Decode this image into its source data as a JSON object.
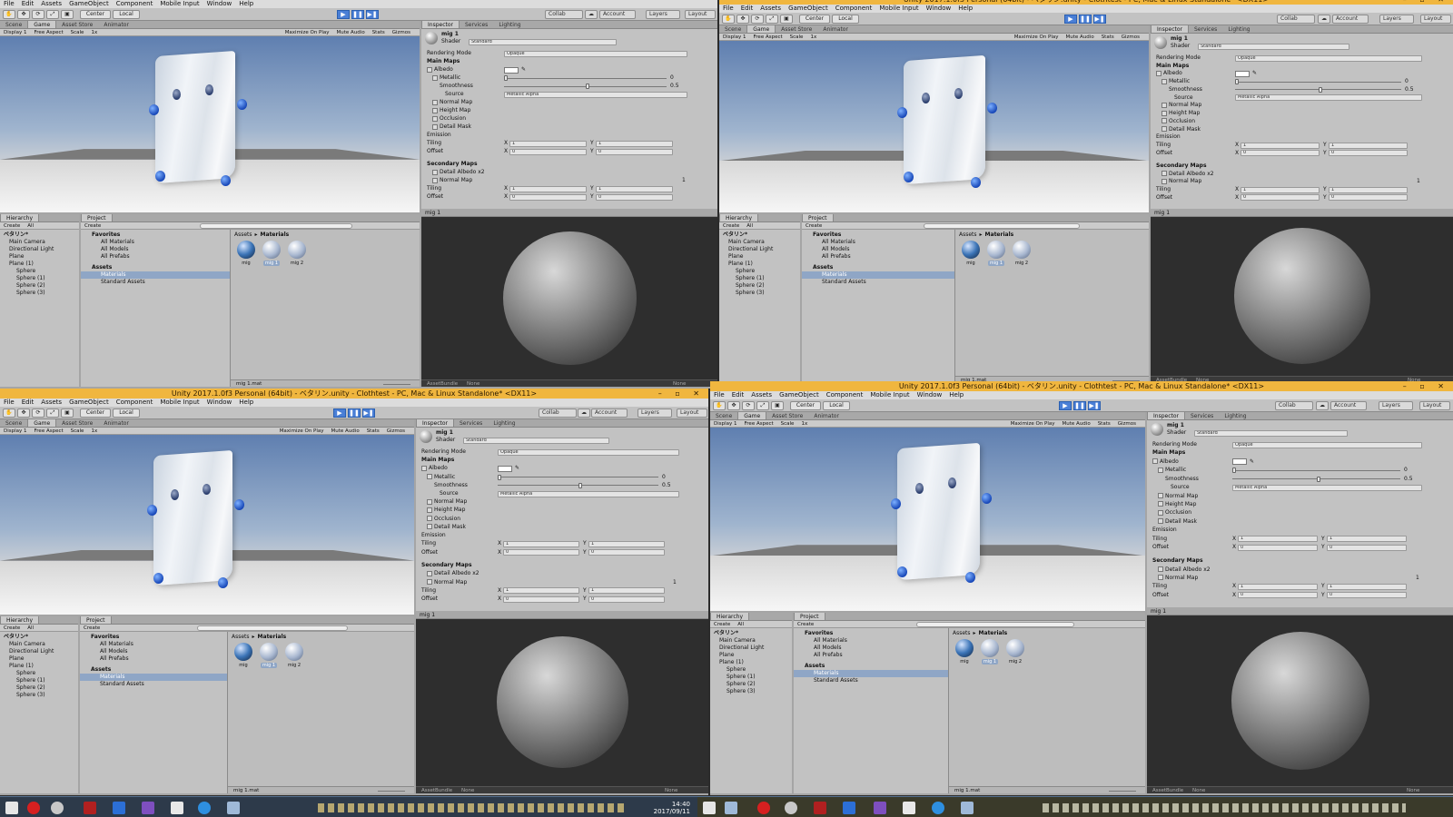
{
  "title": "Unity 2017.1.0f3 Personal (64bit) - ベタリン.unity - Clothtest - PC, Mac & Linux Standalone* <DX11>",
  "menu": [
    "File",
    "Edit",
    "Assets",
    "GameObject",
    "Component",
    "Mobile Input",
    "Window",
    "Help"
  ],
  "toolbar": {
    "center": "Center",
    "local": "Local",
    "collab": "Collab",
    "account": "Account",
    "layers": "Layers",
    "layout": "Layout"
  },
  "tabs": {
    "scene": "Scene",
    "game": "Game",
    "asset_store": "Asset Store",
    "animator": "Animator"
  },
  "game_bar": {
    "display": "Display 1",
    "aspect": "Free Aspect",
    "scale": "Scale",
    "scale_val": "1x",
    "maximize": "Maximize On Play",
    "mute": "Mute Audio",
    "stats": "Stats",
    "gizmos": "Gizmos"
  },
  "inspector": {
    "tabs": [
      "Inspector",
      "Services",
      "Lighting"
    ],
    "name": "mig 1",
    "shader_label": "Shader",
    "shader_value": "Standard",
    "rendering_mode": "Rendering Mode",
    "rendering_value": "Opaque",
    "main_maps": "Main Maps",
    "albedo": "Albedo",
    "metallic": "Metallic",
    "metallic_value": "0",
    "smoothness": "Smoothness",
    "smoothness_value": "0.5",
    "smoothness_level": 0.5,
    "source": "Source",
    "source_value": "Metallic Alpha",
    "normal_map": "Normal Map",
    "height_map": "Height Map",
    "occlusion": "Occlusion",
    "detail_mask": "Detail Mask",
    "emission": "Emission",
    "tiling": "Tiling",
    "offset": "Offset",
    "x": "X",
    "y": "Y",
    "tiling_x": "1",
    "tiling_y": "1",
    "offset_x": "0",
    "offset_y": "0",
    "secondary_maps": "Secondary Maps",
    "detail_albedo": "Detail Albedo x2",
    "normal_map2": "Normal Map",
    "normal_scale": "1"
  },
  "preview": {
    "name": "mig 1",
    "asset_bundle": "AssetBundle",
    "none": "None"
  },
  "hierarchy": {
    "tab": "Hierarchy",
    "create": "Create",
    "search": "All",
    "scene": "ベタリン*",
    "items": [
      "Main Camera",
      "Directional Light",
      "Plane",
      "Plane (1)",
      "Sphere",
      "Sphere (1)",
      "Sphere (2)",
      "Sphere (3)"
    ]
  },
  "project": {
    "tab": "Project",
    "create": "Create",
    "favorites": "Favorites",
    "fav_items": [
      "All Materials",
      "All Models",
      "All Prefabs"
    ],
    "assets": "Assets",
    "asset_items": [
      "Materials",
      "Standard Assets"
    ],
    "breadcrumb_root": "Assets",
    "breadcrumb_sep": "▸",
    "breadcrumb_leaf": "Materials",
    "materials": [
      "mig",
      "mig 1",
      "mig 2"
    ],
    "status": "mig 1.mat"
  },
  "taskbar": {
    "time": "14:40",
    "date": "2017/09/11"
  },
  "colors": {
    "title": "#f0b63f",
    "panel": "#c2c2c2",
    "play": "#4a7fd6"
  }
}
